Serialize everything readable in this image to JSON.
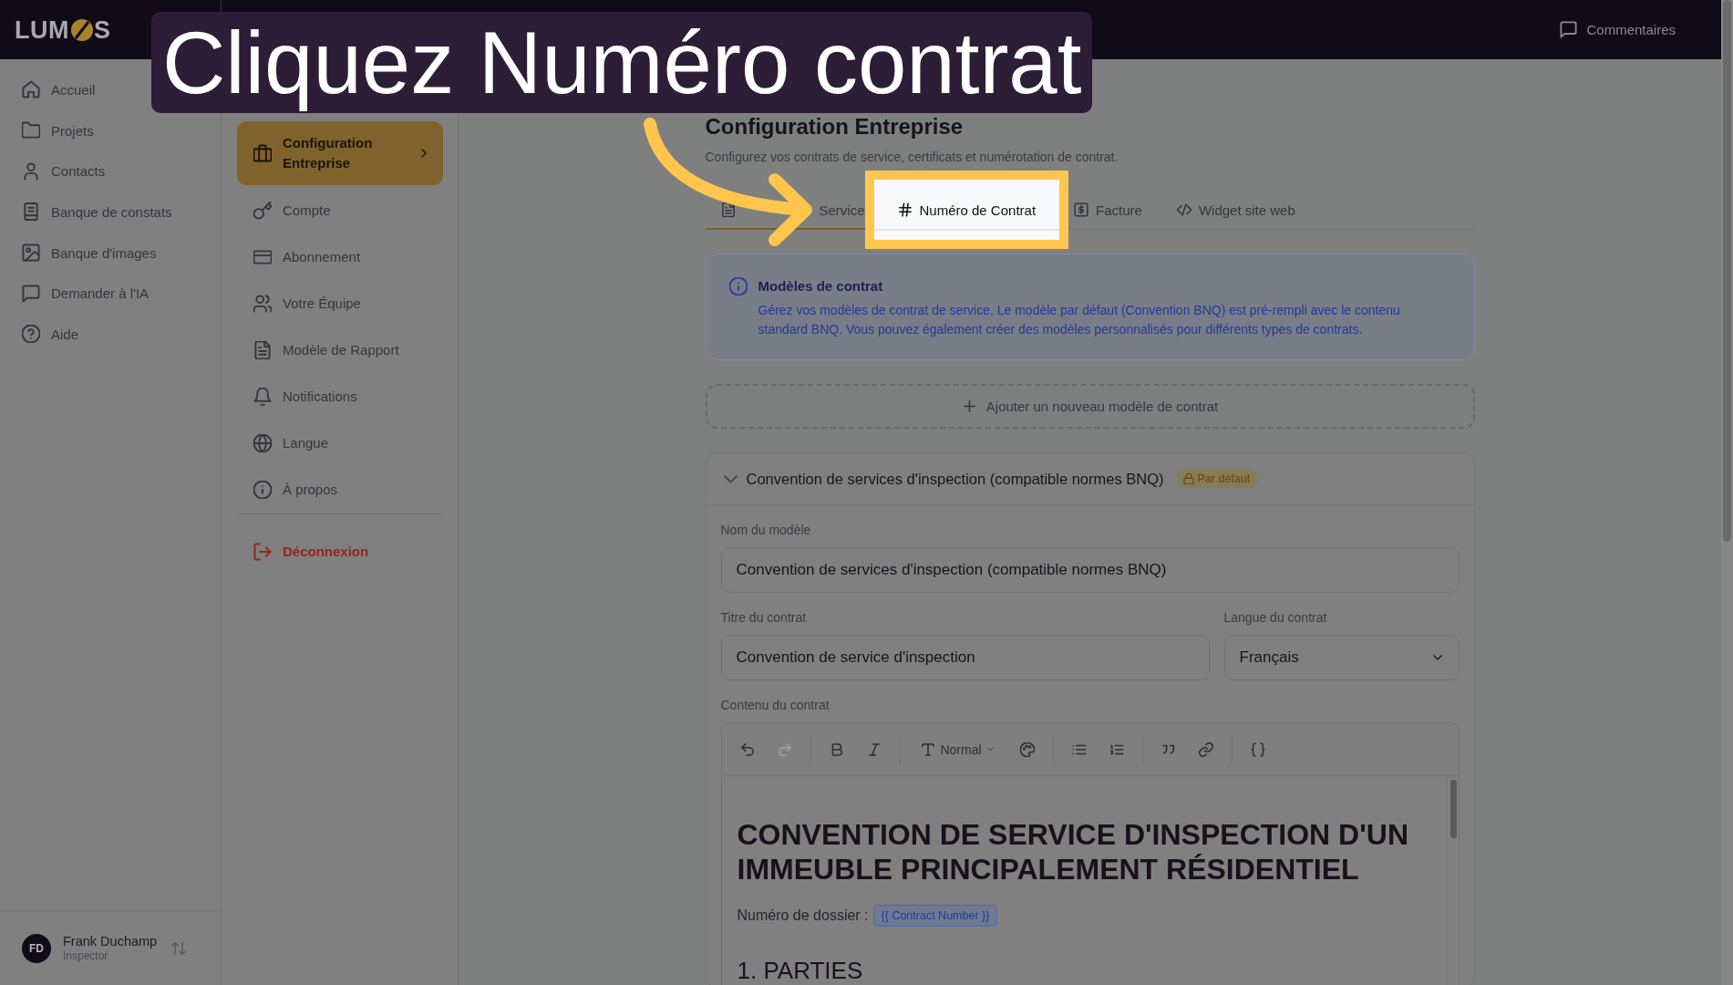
{
  "top_bar": {
    "logo": [
      "LUM",
      "S"
    ],
    "feedback_button": "Commentaires"
  },
  "sidebar": {
    "items": [
      {
        "label": "Accueil"
      },
      {
        "label": "Projets"
      },
      {
        "label": "Contacts"
      },
      {
        "label": "Banque de constats"
      },
      {
        "label": "Banque d'images"
      },
      {
        "label": "Demander à l'IA"
      },
      {
        "label": "Aide"
      }
    ],
    "user": {
      "initials": "FD",
      "name": "Frank Duchamp",
      "role": "Inspector"
    }
  },
  "settings_menu": {
    "items": [
      {
        "label": "Configuration Entreprise",
        "selected": true
      },
      {
        "label": "Compte",
        "selected": false
      },
      {
        "label": "Abonnement",
        "selected": false
      },
      {
        "label": "Votre Équipe",
        "selected": false
      },
      {
        "label": "Modèle de Rapport",
        "selected": false
      },
      {
        "label": "Notifications",
        "selected": false
      },
      {
        "label": "Langue",
        "selected": false
      },
      {
        "label": "À propos",
        "selected": false
      }
    ],
    "logout": "Déconnexion"
  },
  "page": {
    "title": "Configuration Entreprise",
    "subtitle": "Configurez vos contrats de service, certificats et numérotation de contrat.",
    "tabs": [
      {
        "label": "Service",
        "selected": true,
        "highlighted": false
      },
      {
        "label": "Numéro de Contrat",
        "selected": false,
        "highlighted": true
      },
      {
        "label": "Facture",
        "selected": false,
        "highlighted": false
      },
      {
        "label": "Widget site web",
        "selected": false,
        "highlighted": false
      }
    ]
  },
  "info_box": {
    "title": "Modèles de contrat",
    "text": "Gérez vos modèles de contrat de service. Le modèle par défaut (Convention BNQ) est pré-rempli avec le contenu standard BNQ. Vous pouvez également créer des modèles personnalisés pour différents types de contrats."
  },
  "add_template_button": "Ajouter un nouveau modèle de contrat",
  "template": {
    "title": "Convention de services d'inspection (compatible normes BNQ)",
    "expanded": true,
    "badge": "Par défaut",
    "name_field": {
      "label": "Nom du modèle",
      "value": "Convention de services d'inspection (compatible normes BNQ)"
    },
    "title_field": {
      "label": "Titre du contrat",
      "value": "Convention de service d'inspection"
    },
    "language_field": {
      "label": "Langue du contrat",
      "value": "Français"
    },
    "content_field": {
      "label": "Contenu du contrat",
      "toolbar": [
        [
          {
            "kind": "undo",
            "disabled": false
          },
          {
            "kind": "redo",
            "disabled": true
          }
        ],
        [
          {
            "kind": "bold",
            "disabled": false
          },
          {
            "kind": "italic",
            "disabled": false
          }
        ],
        [
          {
            "kind": "text_style",
            "label": "Normal",
            "disabled": false
          },
          {
            "kind": "color",
            "disabled": false
          }
        ],
        [
          {
            "kind": "bullet_list",
            "disabled": false
          },
          {
            "kind": "numbered_list",
            "disabled": false
          }
        ],
        [
          {
            "kind": "quote",
            "disabled": false
          },
          {
            "kind": "link",
            "disabled": false
          }
        ],
        [
          {
            "kind": "variable",
            "disabled": false
          }
        ]
      ],
      "document": {
        "heading": "CONVENTION DE SERVICE D'INSPECTION D'UN IMMEUBLE PRINCIPALEMENT RÉSIDENTIEL",
        "file_number_label": "Numéro de dossier :",
        "file_number_placeholder": "{{ Contract Number }}",
        "section_heading": "1. PARTIES"
      }
    }
  },
  "tutorial": {
    "caption": "Cliquez Numéro contrat"
  }
}
